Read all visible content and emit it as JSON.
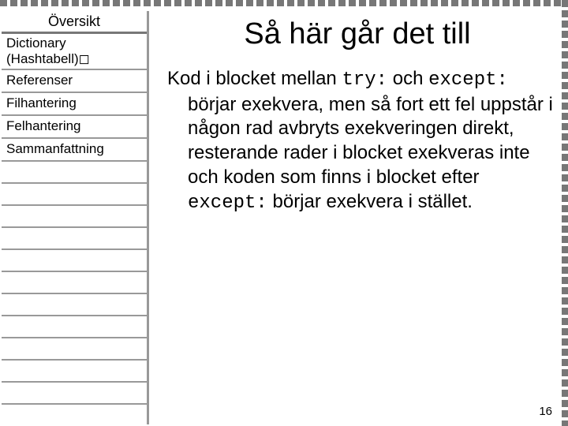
{
  "sidebar": {
    "header": "Översikt",
    "items": [
      "Dictionary (Hashtabell)",
      "Referenser",
      "Filhantering",
      "Felhantering",
      "Sammanfattning"
    ],
    "marker": "◻"
  },
  "content": {
    "title": "Så här går det till",
    "body_pre": "Kod i blocket mellan ",
    "code1": "try:",
    "body_mid1": " och ",
    "code2": "except:",
    "body_mid2": " börjar exekvera, men så fort ett fel uppstår i någon rad avbryts exekveringen direkt, resterande rader i blocket exekveras inte och koden som finns i blocket efter ",
    "code3": "except:",
    "body_post": " börjar exekvera i stället."
  },
  "page_number": "16"
}
